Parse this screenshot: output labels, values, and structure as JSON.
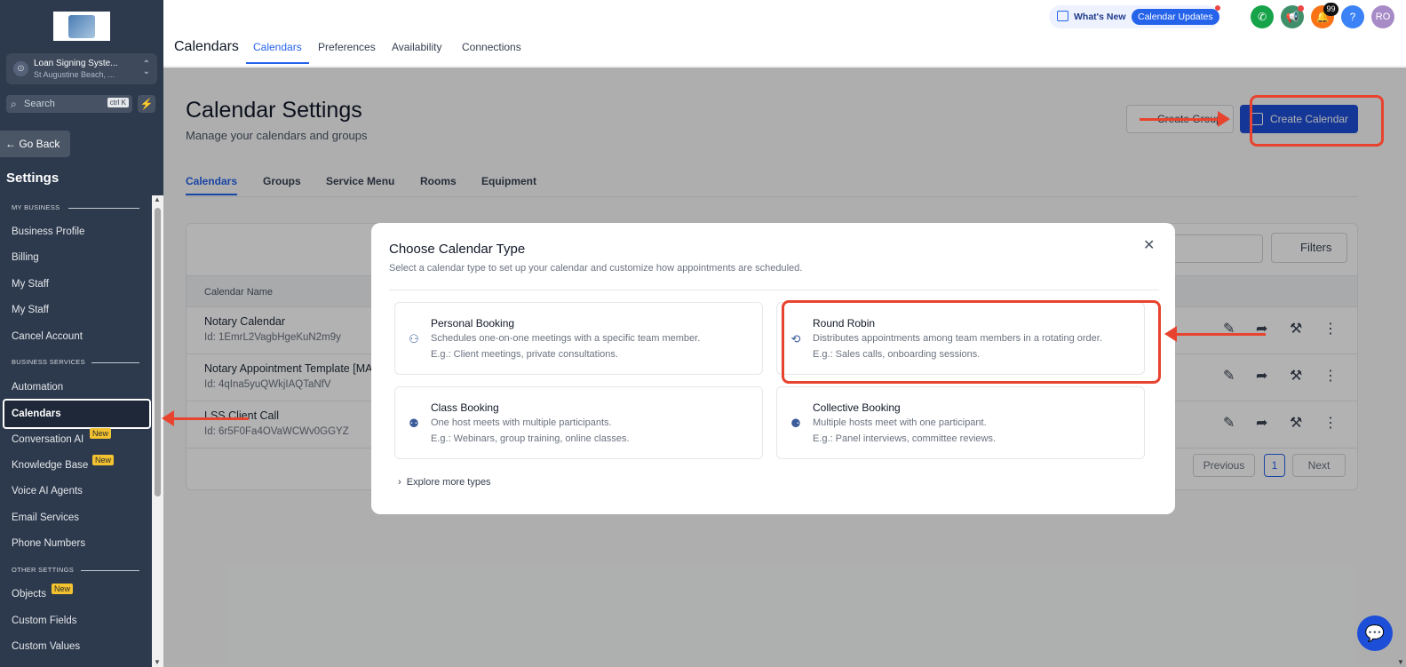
{
  "sidebar": {
    "account_name": "Loan Signing Syste...",
    "account_location": "St Augustine Beach, ...",
    "search_placeholder": "Search",
    "search_shortcut": "ctrl K",
    "go_back": "Go Back",
    "settings_title": "Settings",
    "sections": {
      "my_business": "MY BUSINESS",
      "business_services": "BUSINESS SERVICES",
      "other_settings": "OTHER SETTINGS"
    },
    "items": [
      {
        "label": "Business Profile"
      },
      {
        "label": "Billing"
      },
      {
        "label": "My Staff"
      },
      {
        "label": "My Staff"
      },
      {
        "label": "Cancel Account"
      },
      {
        "label": "Automation"
      },
      {
        "label": "Calendars"
      },
      {
        "label": "Conversation AI",
        "badge": "New"
      },
      {
        "label": "Knowledge Base",
        "badge": "New"
      },
      {
        "label": "Voice AI Agents"
      },
      {
        "label": "Email Services"
      },
      {
        "label": "Phone Numbers"
      },
      {
        "label": "Objects",
        "badge": "New"
      },
      {
        "label": "Custom Fields"
      },
      {
        "label": "Custom Values"
      }
    ]
  },
  "topbar": {
    "page_title": "Calendars",
    "tabs": [
      {
        "label": "Calendars",
        "active": true
      },
      {
        "label": "Preferences"
      },
      {
        "label": "Availability"
      },
      {
        "label": "Connections"
      }
    ],
    "whats_new": "What's New",
    "calendar_updates": "Calendar Updates",
    "notification_count": "99",
    "help": "?",
    "avatar_initials": "RO",
    "colors": {
      "phone": "#16a34a",
      "megaphone": "#3f8f6b",
      "bell": "#f97316",
      "help": "#3b82f6",
      "avatar": "#a78bc7"
    }
  },
  "main": {
    "title": "Calendar Settings",
    "subtitle": "Manage your calendars and groups",
    "create_group": "Create Group",
    "create_calendar": "Create Calendar",
    "subtabs": [
      {
        "label": "Calendars",
        "active": true
      },
      {
        "label": "Groups"
      },
      {
        "label": "Service Menu"
      },
      {
        "label": "Rooms"
      },
      {
        "label": "Equipment"
      }
    ],
    "filters": "Filters",
    "column_name": "Calendar Name",
    "rows": [
      {
        "name": "Notary Calendar",
        "id": "Id: 1EmrL2VagbHgeKuN2m9y"
      },
      {
        "name": "Notary Appointment Template [MA",
        "id": "Id: 4qIna5yuQWkjIAQTaNfV"
      },
      {
        "name": "LSS Client Call",
        "id": "Id: 6r5F0Fa4OVaWCWv0GGYZ"
      }
    ],
    "pagination": {
      "previous": "Previous",
      "page": "1",
      "next": "Next"
    }
  },
  "modal": {
    "title": "Choose Calendar Type",
    "subtitle": "Select a calendar type to set up your calendar and customize how appointments are scheduled.",
    "options": [
      {
        "title": "Personal Booking",
        "desc": "Schedules one-on-one meetings with a specific team member.",
        "example": "E.g.: Client meetings, private consultations."
      },
      {
        "title": "Round Robin",
        "desc": "Distributes appointments among team members in a rotating order.",
        "example": "E.g.: Sales calls, onboarding sessions."
      },
      {
        "title": "Class Booking",
        "desc": "One host meets with multiple participants.",
        "example": "E.g.: Webinars, group training, online classes."
      },
      {
        "title": "Collective Booking",
        "desc": "Multiple hosts meet with one participant.",
        "example": "E.g.: Panel interviews, committee reviews."
      }
    ],
    "explore_more": "Explore more types"
  },
  "annotation_color": "#e8432e"
}
